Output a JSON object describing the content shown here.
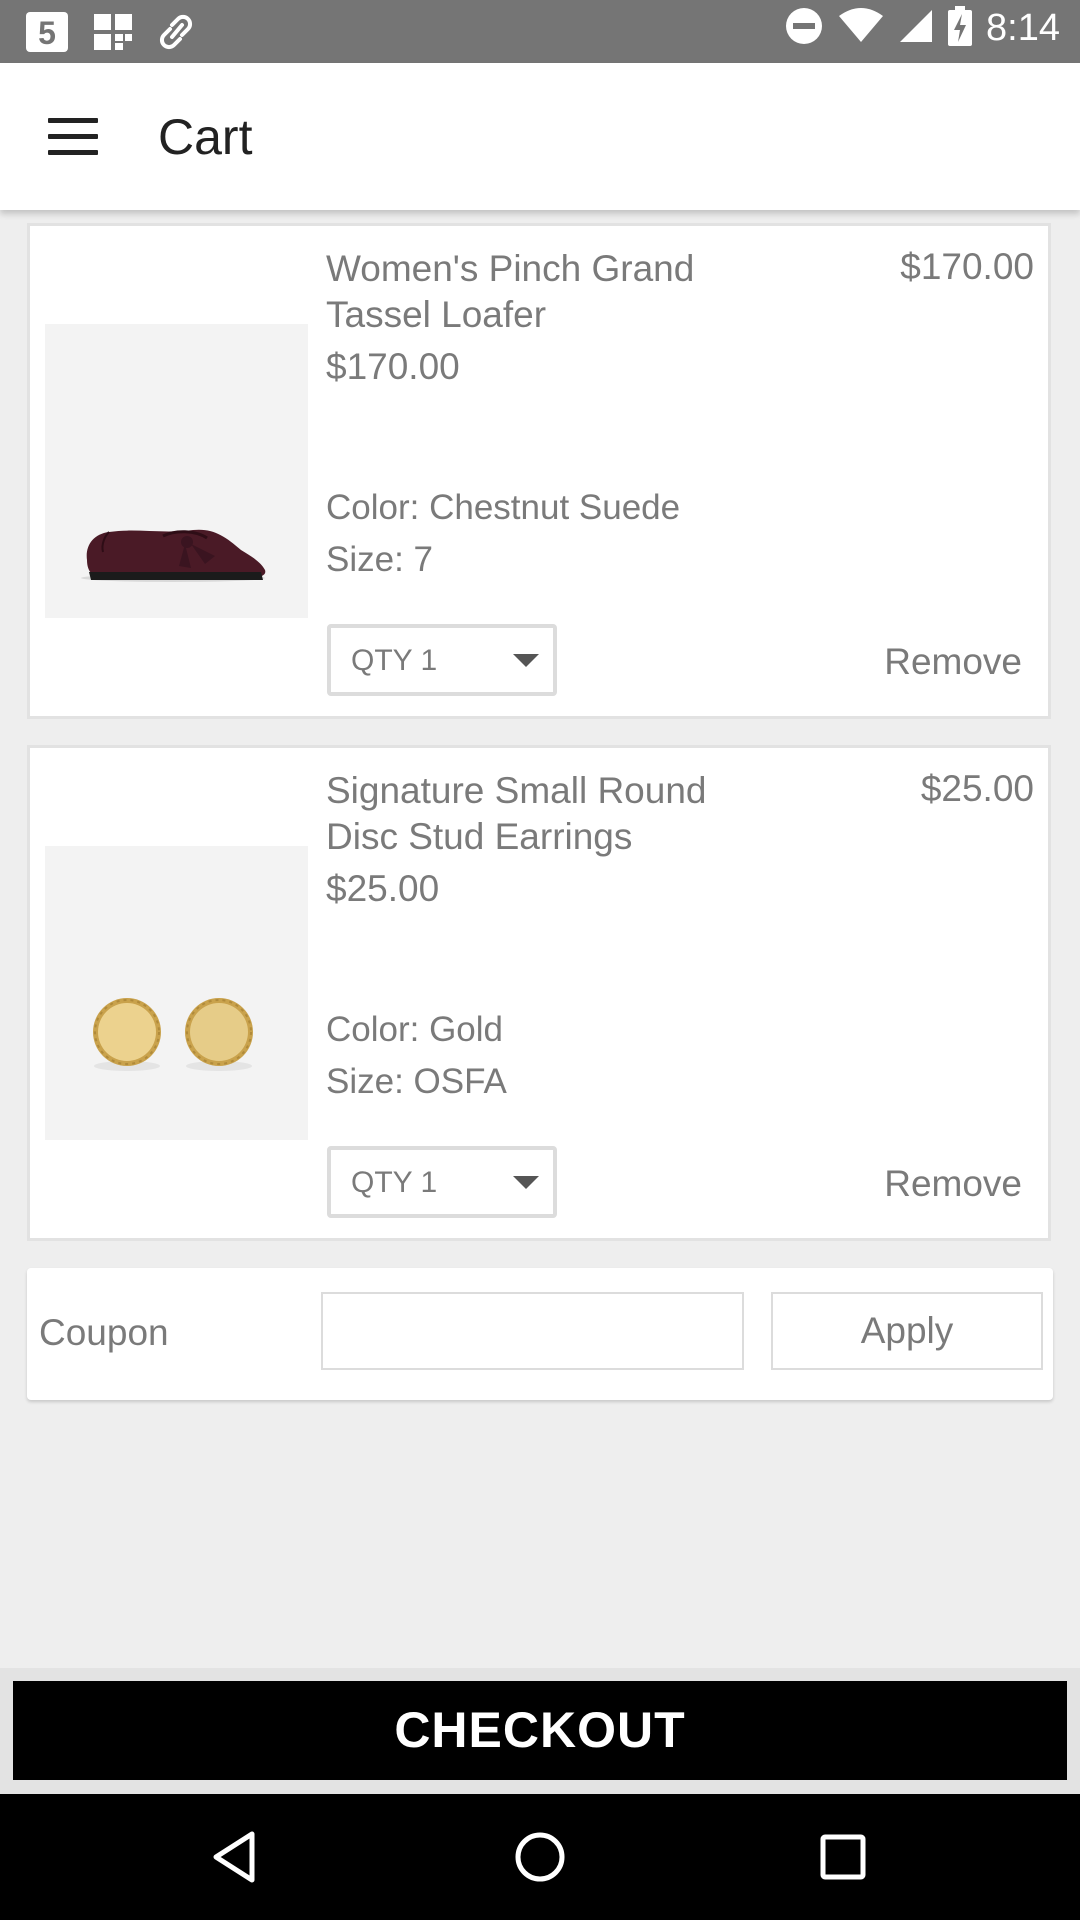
{
  "status_bar": {
    "time": "8:14",
    "left_icons": [
      "sim-5-icon",
      "grid-icon",
      "link-icon"
    ],
    "right_icons": [
      "do-not-disturb-icon",
      "wifi-icon",
      "signal-icon",
      "battery-charging-icon"
    ]
  },
  "app_bar": {
    "title": "Cart",
    "menu_icon": "hamburger-menu-icon"
  },
  "cart": {
    "items": [
      {
        "name": "Women's Pinch Grand Tassel Loafer",
        "unit_price": "$170.00",
        "total": "$170.00",
        "color": "Color: Chestnut Suede",
        "size": "Size: 7",
        "qty_label": "QTY 1",
        "remove_label": "Remove",
        "image_icon": "loafer-shoe-image"
      },
      {
        "name": "Signature Small Round Disc Stud Earrings",
        "unit_price": "$25.00",
        "total": "$25.00",
        "color": "Color: Gold",
        "size": "Size: OSFA",
        "qty_label": "QTY 1",
        "remove_label": "Remove",
        "image_icon": "stud-earrings-image"
      }
    ]
  },
  "coupon": {
    "label": "Coupon",
    "input_value": "",
    "apply_label": "Apply"
  },
  "checkout": {
    "label": "CHECKOUT"
  },
  "nav_bar": {
    "icons": [
      "back-icon",
      "home-icon",
      "recents-icon"
    ]
  },
  "colors": {
    "status_bar": "#757575",
    "app_bar": "#ffffff",
    "background": "#eeeeee",
    "checkout_button": "#000000",
    "text_gray": "#7a7a7a"
  }
}
